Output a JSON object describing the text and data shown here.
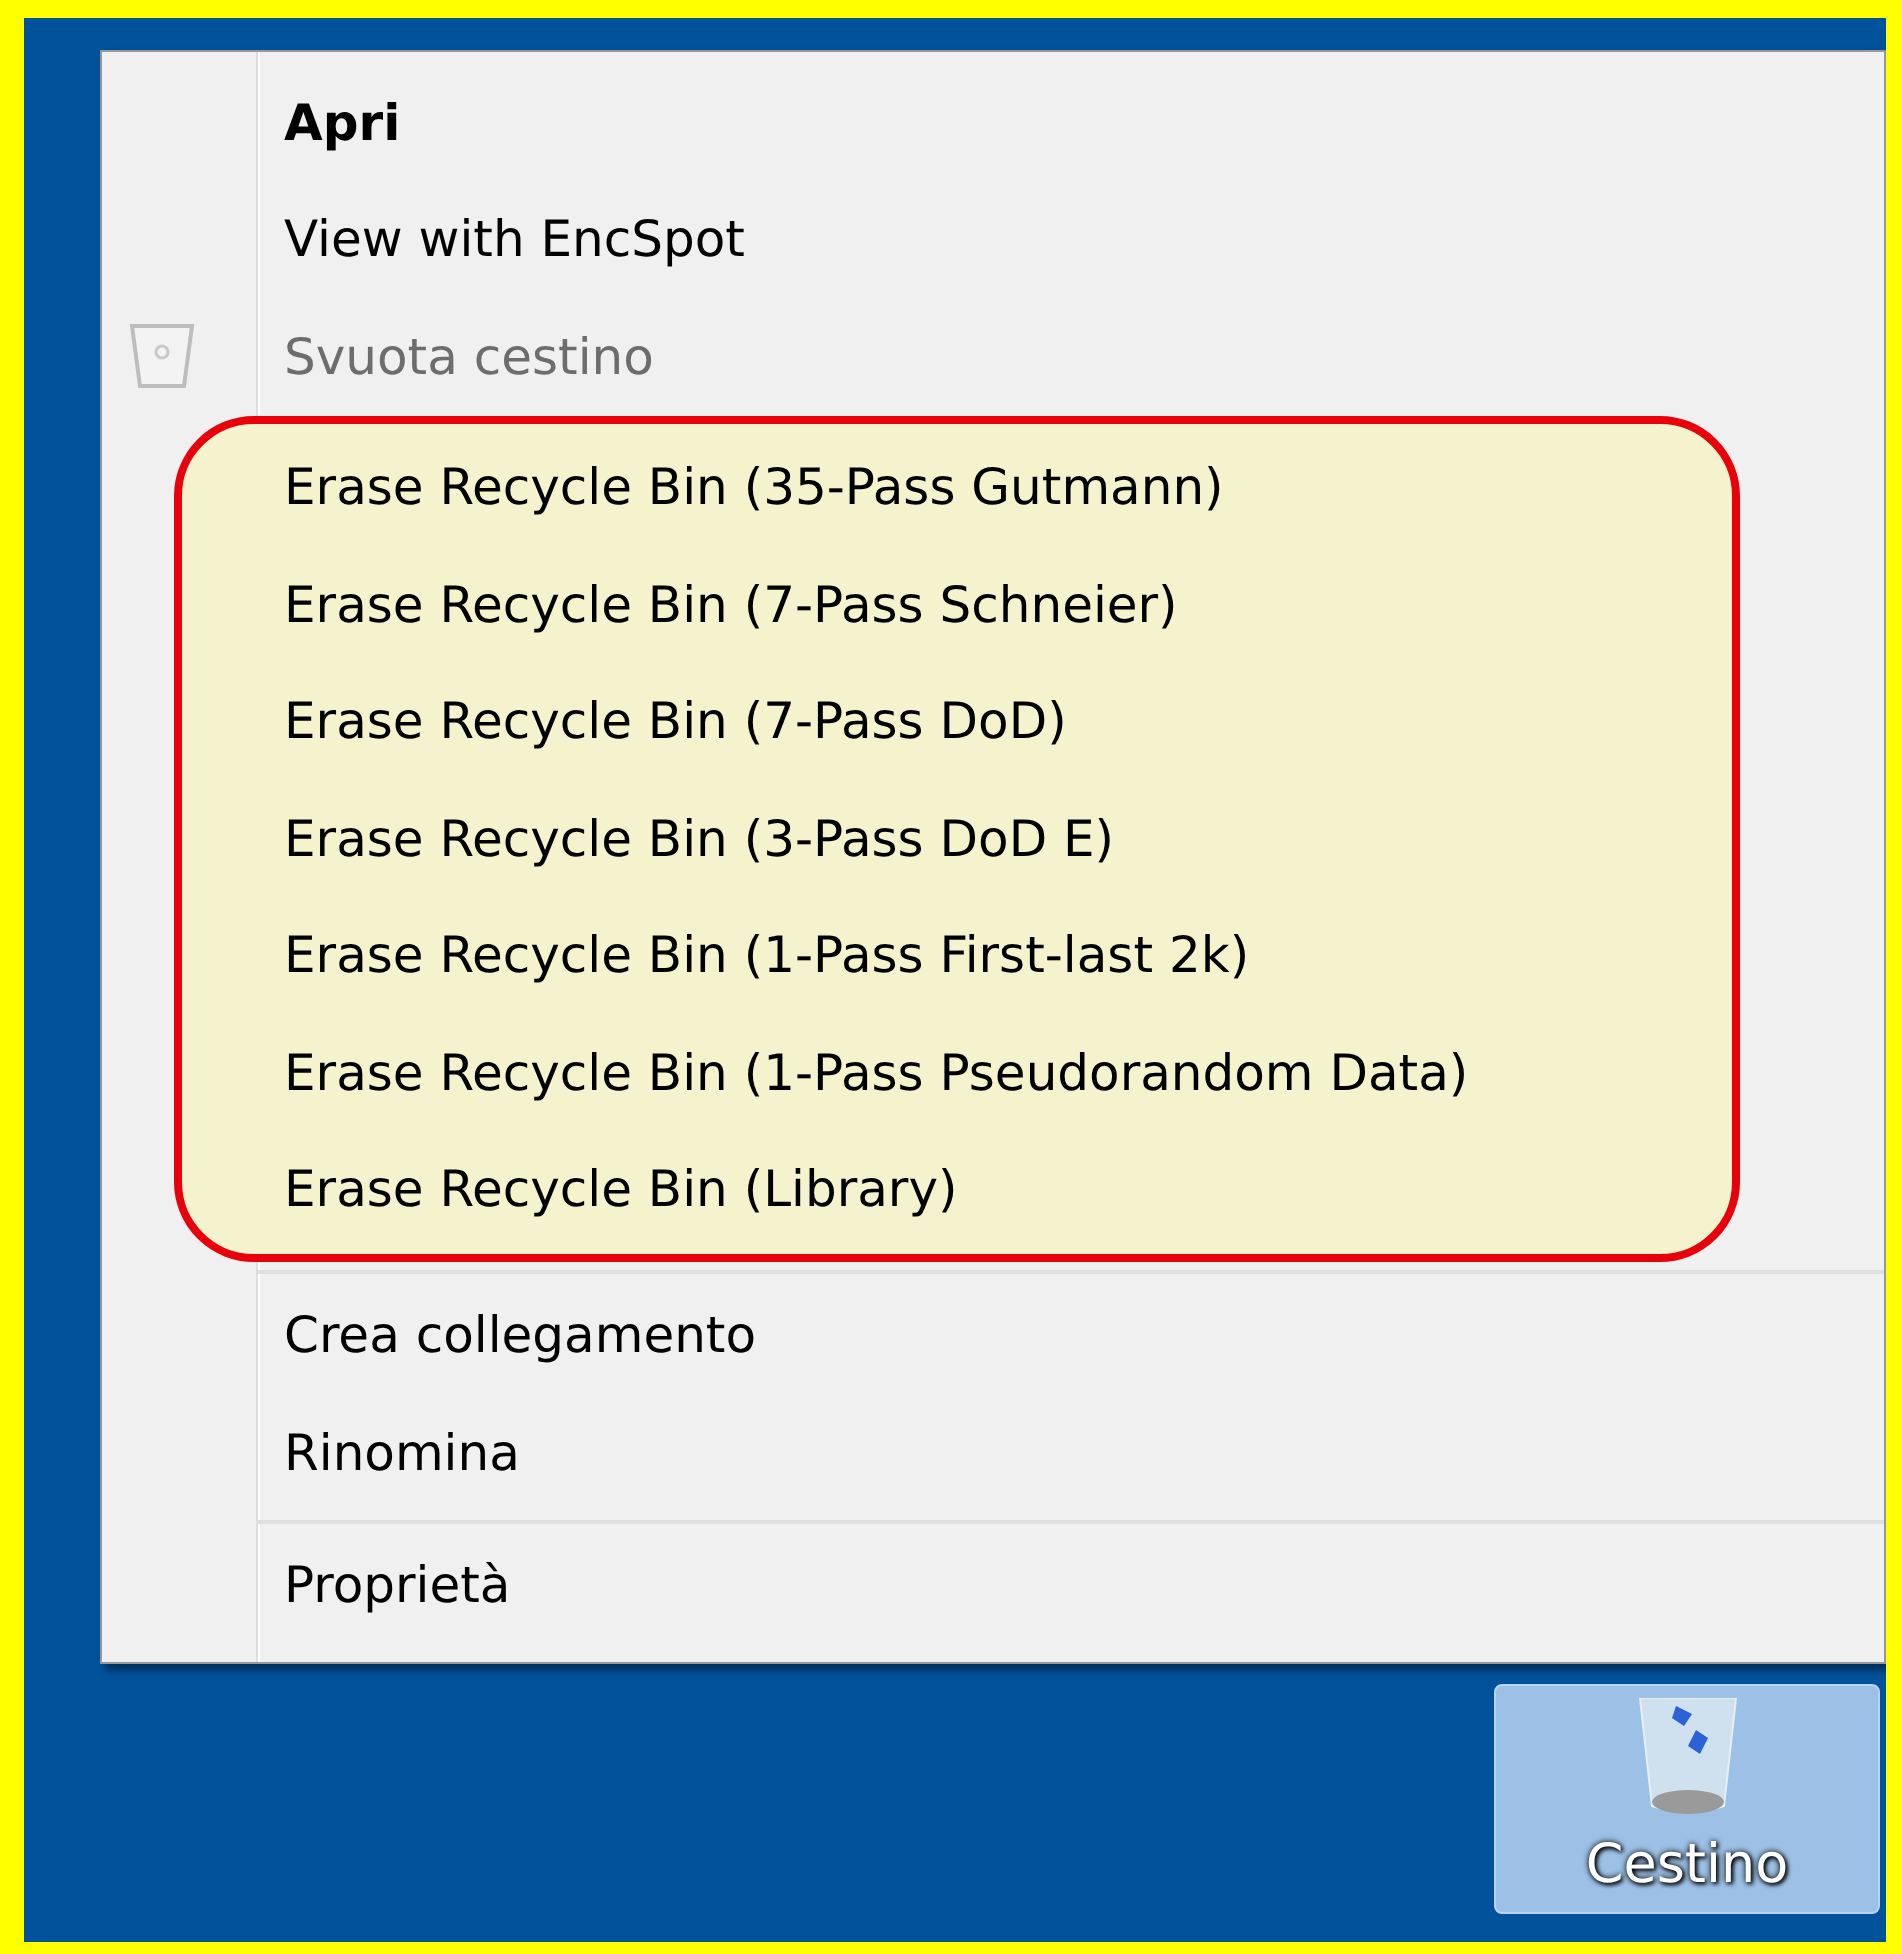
{
  "menu": {
    "groups": [
      {
        "separated": false,
        "highlighted": false,
        "items": [
          {
            "label": "Apri",
            "default": true,
            "disabled": false,
            "kind": "plain"
          },
          {
            "label": "View with EncSpot",
            "default": false,
            "disabled": false,
            "kind": "plain"
          },
          {
            "label": "Svuota cestino",
            "default": false,
            "disabled": true,
            "kind": "icon"
          }
        ]
      },
      {
        "separated": false,
        "highlighted": true,
        "items": [
          {
            "label": "Erase Recycle Bin (35-Pass Gutmann)",
            "default": false,
            "disabled": false,
            "kind": "plain"
          },
          {
            "label": "Erase Recycle Bin (7-Pass Schneier)",
            "default": false,
            "disabled": false,
            "kind": "plain"
          },
          {
            "label": "Erase Recycle Bin (7-Pass DoD)",
            "default": false,
            "disabled": false,
            "kind": "plain"
          },
          {
            "label": "Erase Recycle Bin (3-Pass DoD E)",
            "default": false,
            "disabled": false,
            "kind": "plain"
          },
          {
            "label": "Erase Recycle Bin (1-Pass First-last 2k)",
            "default": false,
            "disabled": false,
            "kind": "plain"
          },
          {
            "label": "Erase Recycle Bin (1-Pass Pseudorandom Data)",
            "default": false,
            "disabled": false,
            "kind": "plain"
          },
          {
            "label": "Erase Recycle Bin (Library)",
            "default": false,
            "disabled": false,
            "kind": "plain"
          }
        ]
      },
      {
        "separated": true,
        "highlighted": false,
        "items": [
          {
            "label": "Crea collegamento",
            "default": false,
            "disabled": false,
            "kind": "plain"
          },
          {
            "label": "Rinomina",
            "default": false,
            "disabled": false,
            "kind": "plain"
          }
        ]
      },
      {
        "separated": true,
        "highlighted": false,
        "items": [
          {
            "label": "Proprietà",
            "default": false,
            "disabled": false,
            "kind": "plain"
          }
        ]
      }
    ]
  },
  "desktop_icon": {
    "label": "Cestino",
    "selected": true
  }
}
